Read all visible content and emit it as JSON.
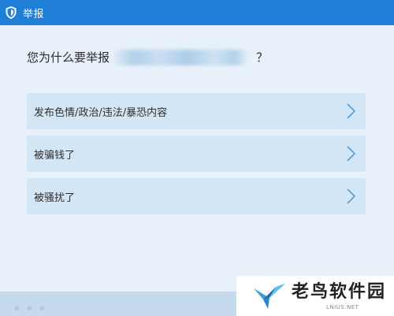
{
  "window": {
    "title": "举报",
    "title_icon": "shield-icon"
  },
  "prompt": {
    "text": "您为什么要举报",
    "question_mark": "？"
  },
  "options": [
    {
      "label": "发布色情/政治/违法/暴恐内容",
      "icon": "chevron-right-icon"
    },
    {
      "label": "被骗钱了",
      "icon": "chevron-right-icon"
    },
    {
      "label": "被骚扰了",
      "icon": "chevron-right-icon"
    }
  ],
  "watermark": {
    "text": "老鸟软件园",
    "sub": "LNIUS.NET"
  },
  "colors": {
    "titlebar": "#1f7fd6",
    "background": "#e8f1f9",
    "option_bg": "#d3e6f5",
    "chevron": "#5b9bd0"
  }
}
